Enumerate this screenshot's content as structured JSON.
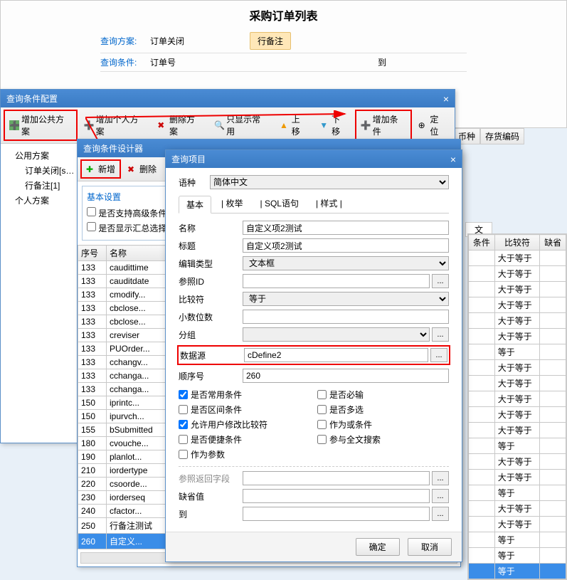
{
  "main": {
    "title": "采购订单列表",
    "query_scheme_label": "查询方案:",
    "query_scheme_value": "订单关闭",
    "badge_button": "行备注",
    "query_cond_label": "查询条件:",
    "query_cond_value": "订单号",
    "to_label": "到"
  },
  "header_cols": {
    "c1": "币种",
    "c2": "存货编码"
  },
  "config": {
    "title": "查询条件配置",
    "toolbar": {
      "add_public": "增加公共方案",
      "add_personal": "增加个人方案",
      "delete": "删除方案",
      "show_common": "只显示常用",
      "move_up": "上移",
      "move_down": "下移",
      "add_cond": "增加条件",
      "locate": "定位"
    },
    "tree": {
      "public": "公用方案",
      "order_close": "订单关闭[s…",
      "remark": "行备注[1]",
      "personal": "个人方案"
    }
  },
  "designer": {
    "title": "查询条件设计器",
    "toolbar": {
      "add": "新增",
      "del": "删除"
    },
    "basic": {
      "legend": "基本设置",
      "adv": "是否支持高级条件",
      "sum": "是否显示汇总选择"
    },
    "cols": {
      "seq": "序号",
      "name": "名称"
    },
    "rows": [
      {
        "seq": "133",
        "name": "caudittime"
      },
      {
        "seq": "133",
        "name": "cauditdate"
      },
      {
        "seq": "133",
        "name": "cmodify..."
      },
      {
        "seq": "133",
        "name": "cbclose..."
      },
      {
        "seq": "133",
        "name": "cbclose..."
      },
      {
        "seq": "133",
        "name": "creviser"
      },
      {
        "seq": "133",
        "name": "PUOrder..."
      },
      {
        "seq": "133",
        "name": "cchangv..."
      },
      {
        "seq": "133",
        "name": "cchanga..."
      },
      {
        "seq": "133",
        "name": "cchanga..."
      },
      {
        "seq": "150",
        "name": "iprintc..."
      },
      {
        "seq": "150",
        "name": "ipurvch..."
      },
      {
        "seq": "155",
        "name": "bSubmitted"
      },
      {
        "seq": "180",
        "name": "cvouche..."
      },
      {
        "seq": "190",
        "name": "planlot..."
      },
      {
        "seq": "210",
        "name": "iordertype"
      },
      {
        "seq": "220",
        "name": "csoorde..."
      },
      {
        "seq": "230",
        "name": "iorderseq"
      },
      {
        "seq": "240",
        "name": "cfactor..."
      },
      {
        "seq": "250",
        "name": "行备注测试"
      },
      {
        "seq": "260",
        "name": "自定义..."
      }
    ]
  },
  "right": {
    "lang_hint": "文",
    "cols": {
      "cond": "条件",
      "cmp": "比较符",
      "def": "缺省"
    },
    "vals": [
      "大于等于",
      "大于等于",
      "大于等于",
      "大于等于",
      "大于等于",
      "大于等于",
      "等于",
      "大于等于",
      "大于等于",
      "大于等于",
      "大于等于",
      "大于等于",
      "等于",
      "大于等于",
      "大于等于",
      "等于",
      "大于等于",
      "大于等于",
      "等于",
      "等于",
      "等于"
    ]
  },
  "dialog": {
    "title": "查询项目",
    "lang_label": "语种",
    "lang_value": "简体中文",
    "tabs": {
      "basic": "基本",
      "enum": "枚举",
      "sql": "SQL语句",
      "style": "样式"
    },
    "fields": {
      "name_l": "名称",
      "name_v": "自定义项2测试",
      "title_l": "标题",
      "title_v": "自定义项2测试",
      "edit_l": "编辑类型",
      "edit_v": "文本框",
      "ref_l": "参照ID",
      "cmp_l": "比较符",
      "cmp_v": "等于",
      "dec_l": "小数位数",
      "grp_l": "分组",
      "ds_l": "数据源",
      "ds_v": "cDefine2",
      "ord_l": "顺序号",
      "ord_v": "260"
    },
    "checks": {
      "common": "是否常用条件",
      "required": "是否必输",
      "interval": "是否区间条件",
      "multi": "是否多选",
      "allow_mod": "允许用户修改比较符",
      "as_or": "作为或条件",
      "quick": "是否便捷条件",
      "fulltext": "参与全文搜索",
      "as_param": "作为参数",
      "ref_ret": "参照返回字段",
      "default": "缺省值",
      "to": "到"
    },
    "ok": "确定",
    "cancel": "取消"
  }
}
